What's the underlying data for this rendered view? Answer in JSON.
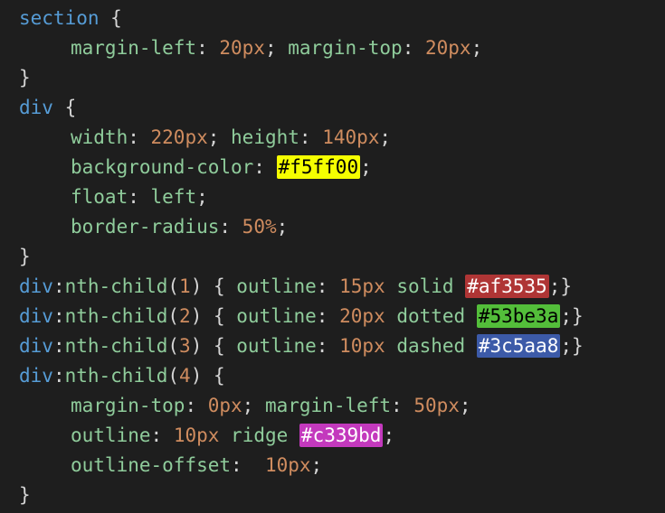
{
  "colors": {
    "background": "#1e1e1e",
    "selector": "#569cd6",
    "property": "#8fcc9b",
    "number": "#cf8c5f",
    "punctuation": "#d4d4d4"
  },
  "code": {
    "l1": {
      "selector": "section",
      "brace": " {"
    },
    "l2": {
      "p1": "margin-left",
      "v1": "20px",
      "p2": "margin-top",
      "v2": "20px"
    },
    "l3": {
      "brace": "}"
    },
    "l4": {
      "selector": "div",
      "brace": " {"
    },
    "l5": {
      "p1": "width",
      "v1": "220px",
      "p2": "height",
      "v2": "140px"
    },
    "l6": {
      "p1": "background-color",
      "swatch": "#f5ff00"
    },
    "l7": {
      "p1": "float",
      "v1": "left"
    },
    "l8": {
      "p1": "border-radius",
      "v1": "50%"
    },
    "l9": {
      "brace": "}"
    },
    "l10": {
      "selector": "div",
      "pseudo": "nth-child",
      "arg": "1",
      "prop": "outline",
      "size": "15px",
      "style": "solid",
      "swatch": "#af3535"
    },
    "l11": {
      "selector": "div",
      "pseudo": "nth-child",
      "arg": "2",
      "prop": "outline",
      "size": "20px",
      "style": "dotted",
      "swatch": "#53be3a"
    },
    "l12": {
      "selector": "div",
      "pseudo": "nth-child",
      "arg": "3",
      "prop": "outline",
      "size": "10px",
      "style": "dashed",
      "swatch": "#3c5aa8"
    },
    "l13": {
      "selector": "div",
      "pseudo": "nth-child",
      "arg": "4"
    },
    "l14": {
      "p1": "margin-top",
      "v1": "0px",
      "p2": "margin-left",
      "v2": "50px"
    },
    "l15": {
      "p1": "outline",
      "size": "10px",
      "style": "ridge",
      "swatch": "#c339bd"
    },
    "l16": {
      "p1": "outline-offset",
      "v1": "10px"
    },
    "l17": {
      "brace": "}"
    }
  }
}
